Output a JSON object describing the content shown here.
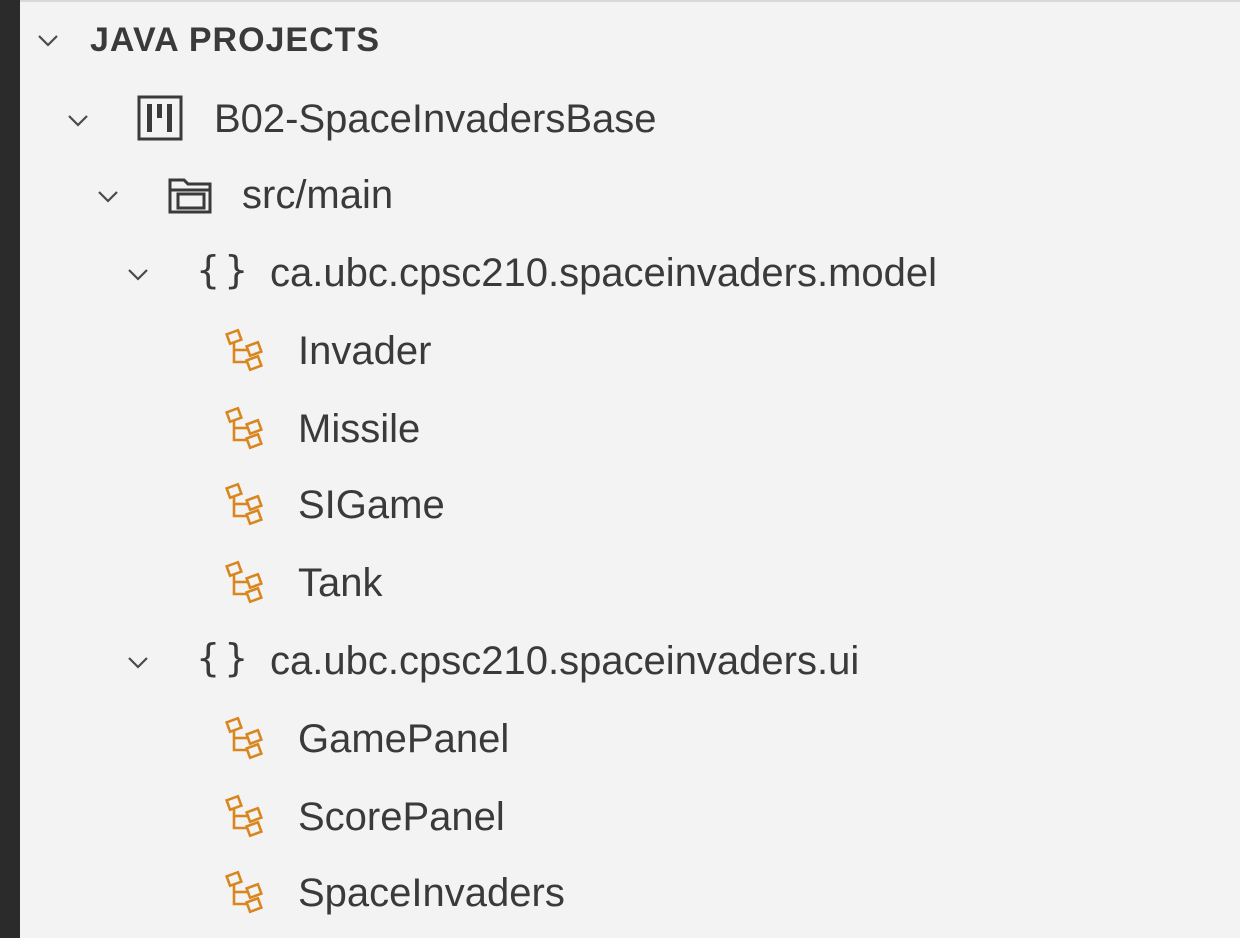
{
  "explorer": {
    "section_title": "JAVA PROJECTS",
    "project": {
      "name": "B02-SpaceInvadersBase",
      "icon": "project-icon"
    },
    "source_folder": {
      "name": "src/main",
      "icon": "folder-icon"
    },
    "packages": [
      {
        "name": "ca.ubc.cpsc210.spaceinvaders.model",
        "icon": "package-braces-icon",
        "classes": [
          "Invader",
          "Missile",
          "SIGame",
          "Tank"
        ]
      },
      {
        "name": "ca.ubc.cpsc210.spaceinvaders.ui",
        "icon": "package-braces-icon",
        "classes": [
          "GamePanel",
          "ScorePanel",
          "SpaceInvaders"
        ]
      }
    ],
    "class_icon": "class-hierarchy-icon",
    "colors": {
      "class_icon": "#d9861f",
      "text": "#3a3a3a",
      "background": "#f3f3f3",
      "left_bar": "#2b2b2b"
    }
  }
}
